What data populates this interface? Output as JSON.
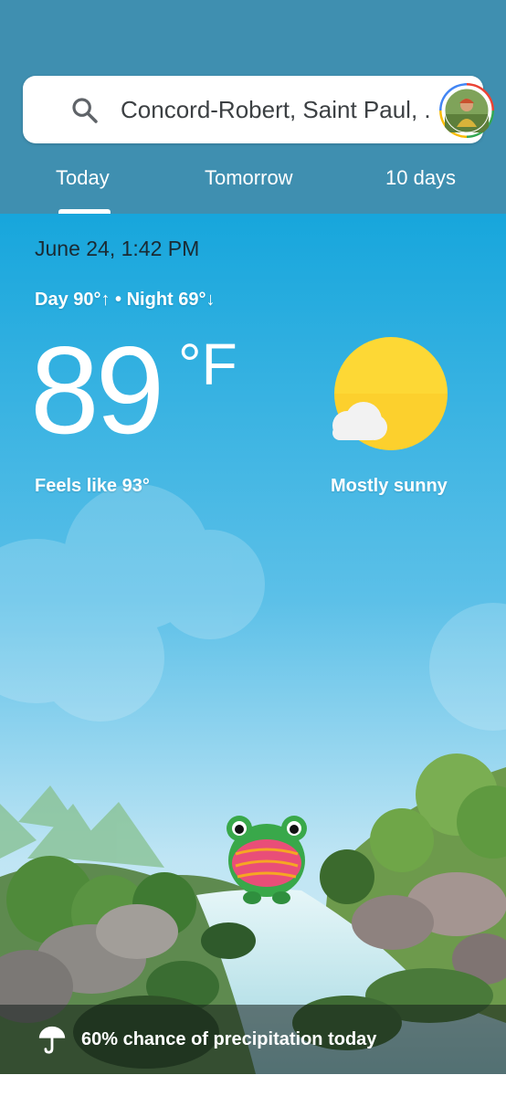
{
  "search": {
    "location": "Concord-Robert, Saint Paul, ..."
  },
  "tabs": [
    {
      "label": "Today",
      "selected": true
    },
    {
      "label": "Tomorrow",
      "selected": false
    },
    {
      "label": "10 days",
      "selected": false
    }
  ],
  "weather": {
    "date_time": "June 24, 1:42 PM",
    "day_night": "Day 90°↑ • Night 69°↓",
    "temperature": "89",
    "unit": "°F",
    "feels_like": "Feels like 93°",
    "condition": "Mostly sunny",
    "condition_icon": "sun-with-cloud-icon"
  },
  "precipitation": {
    "text": "60% chance of precipitation today",
    "icon": "umbrella-icon"
  },
  "colors": {
    "header": "#3f8fb0",
    "sky_top": "#1aa8dc",
    "sun": "#fdd835"
  }
}
